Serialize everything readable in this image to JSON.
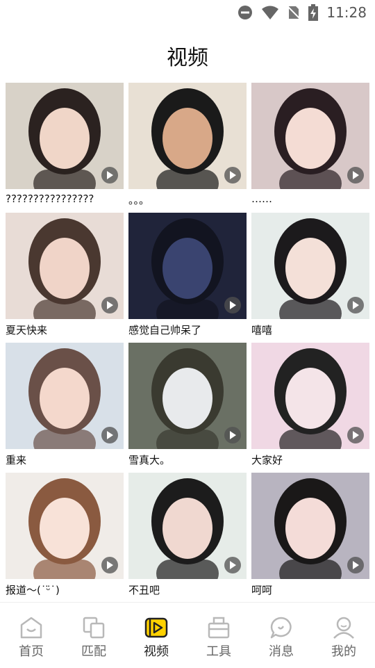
{
  "status_bar": {
    "time": "11:28"
  },
  "page": {
    "title": "视频"
  },
  "videos": [
    {
      "caption": "????????????????",
      "bg": "#d8d2c8",
      "face": "#f0d6c8",
      "hair": "#2b2220"
    },
    {
      "caption": "。。。",
      "bg": "#e8e0d4",
      "face": "#d8a888",
      "hair": "#1a1a1a"
    },
    {
      "caption": "……",
      "bg": "#d8c8c8",
      "face": "#f4dcd4",
      "hair": "#2a1e22"
    },
    {
      "caption": "夏天快来",
      "bg": "#e8dcd6",
      "face": "#f0d4c8",
      "hair": "#4a3830"
    },
    {
      "caption": "感觉自己帅呆了",
      "bg": "#20243a",
      "face": "#3a4470",
      "hair": "#121420"
    },
    {
      "caption": "嘻嘻",
      "bg": "#e6ecea",
      "face": "#f4e0d8",
      "hair": "#1c1a1c"
    },
    {
      "caption": "重来",
      "bg": "#d8e0e8",
      "face": "#f4d8cc",
      "hair": "#6a5048"
    },
    {
      "caption": "雪真大。",
      "bg": "#6a7064",
      "face": "#e8eaec",
      "hair": "#3a3a30"
    },
    {
      "caption": "大家好",
      "bg": "#f0d8e4",
      "face": "#f4e4e8",
      "hair": "#222"
    },
    {
      "caption": "报道～(˙ᵕ̈˙)",
      "bg": "#f0ece8",
      "face": "#f8e2d8",
      "hair": "#8a5a40"
    },
    {
      "caption": "不丑吧",
      "bg": "#e6ece8",
      "face": "#f0d8d0",
      "hair": "#1c1c1c"
    },
    {
      "caption": "呵呵",
      "bg": "#b8b4c0",
      "face": "#f4dcd8",
      "hair": "#1a1818"
    }
  ],
  "tabs": [
    {
      "label": "首页",
      "icon": "home-icon"
    },
    {
      "label": "匹配",
      "icon": "match-icon"
    },
    {
      "label": "视频",
      "icon": "video-icon",
      "active": true
    },
    {
      "label": "工具",
      "icon": "tools-icon"
    },
    {
      "label": "消息",
      "icon": "message-icon"
    },
    {
      "label": "我的",
      "icon": "profile-icon"
    }
  ],
  "colors": {
    "accent": "#ffd200",
    "tab_icon": "#b8b8b8"
  }
}
